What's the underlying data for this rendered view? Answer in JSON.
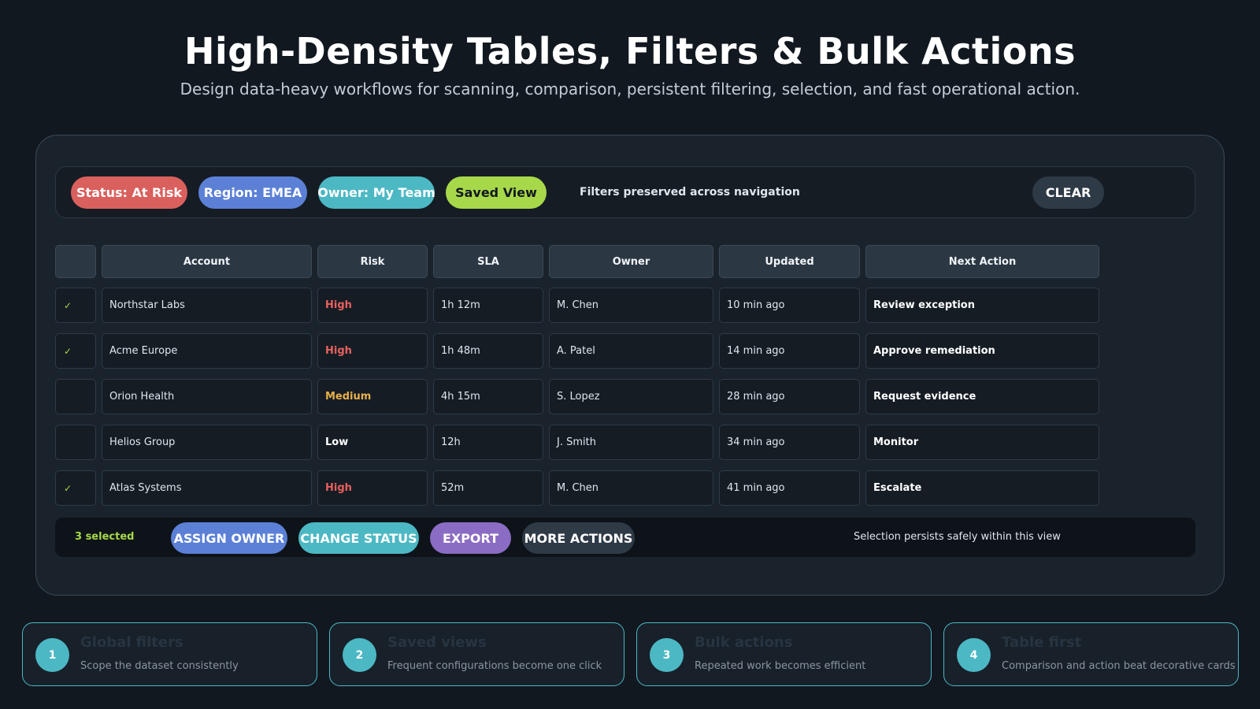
{
  "header": {
    "title": "High-Density Tables, Filters & Bulk Actions",
    "subtitle": "Design data-heavy workflows for scanning, comparison, persistent filtering, selection, and fast operational action."
  },
  "filters": {
    "chips": [
      {
        "label": "Status: At Risk",
        "color": "#d9605d"
      },
      {
        "label": "Region: EMEA",
        "color": "#5b80d6"
      },
      {
        "label": "Owner: My Team",
        "color": "#4cb8c4"
      },
      {
        "label": "Saved View",
        "color": "#a7d84a"
      }
    ],
    "note": "Filters preserved across navigation",
    "clear_label": "CLEAR"
  },
  "table": {
    "headers": [
      "",
      "Account",
      "Risk",
      "SLA",
      "Owner",
      "Updated",
      "Next Action"
    ],
    "rows": [
      {
        "selected": "✓",
        "account": "Northstar Labs",
        "risk": "High",
        "sla": "1h 12m",
        "owner": "M. Chen",
        "updated": "10 min ago",
        "next_action": "Review exception"
      },
      {
        "selected": "✓",
        "account": "Acme Europe",
        "risk": "High",
        "sla": "1h 48m",
        "owner": "A. Patel",
        "updated": "14 min ago",
        "next_action": "Approve remediation"
      },
      {
        "selected": "",
        "account": "Orion Health",
        "risk": "Medium",
        "sla": "4h 15m",
        "owner": "S. Lopez",
        "updated": "28 min ago",
        "next_action": "Request evidence"
      },
      {
        "selected": "",
        "account": "Helios Group",
        "risk": "Low",
        "sla": "12h",
        "owner": "J. Smith",
        "updated": "34 min ago",
        "next_action": "Monitor"
      },
      {
        "selected": "✓",
        "account": "Atlas Systems",
        "risk": "High",
        "sla": "52m",
        "owner": "M. Chen",
        "updated": "41 min ago",
        "next_action": "Escalate"
      }
    ]
  },
  "bulk": {
    "selected_count": "3 selected",
    "actions": [
      {
        "label": "ASSIGN OWNER",
        "color": "#5b80d6"
      },
      {
        "label": "CHANGE STATUS",
        "color": "#4cb8c4"
      },
      {
        "label": "EXPORT",
        "color": "#8a6cc4"
      },
      {
        "label": "MORE ACTIONS",
        "color": "#2e3a46"
      }
    ],
    "note": "Selection persists safely within this view"
  },
  "steps": [
    {
      "num": "1",
      "title": "Global filters",
      "desc": "Scope the dataset consistently"
    },
    {
      "num": "2",
      "title": "Saved views",
      "desc": "Frequent configurations become one click"
    },
    {
      "num": "3",
      "title": "Bulk actions",
      "desc": "Repeated work becomes efficient"
    },
    {
      "num": "4",
      "title": "Table first",
      "desc": "Comparison and action beat decorative cards"
    }
  ]
}
